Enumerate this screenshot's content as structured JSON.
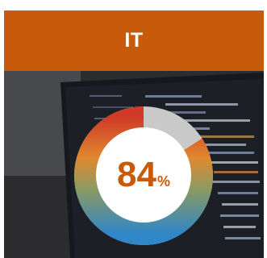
{
  "card": {
    "title": "IT",
    "accent_color": "#c85a0c",
    "gauge": {
      "value": 84,
      "value_label": "84",
      "unit": "%",
      "track_color": "#c9c9c9",
      "gradient_colors": [
        "#2f86c8",
        "#8f9a5e",
        "#e08930",
        "#cf3b26"
      ]
    }
  }
}
